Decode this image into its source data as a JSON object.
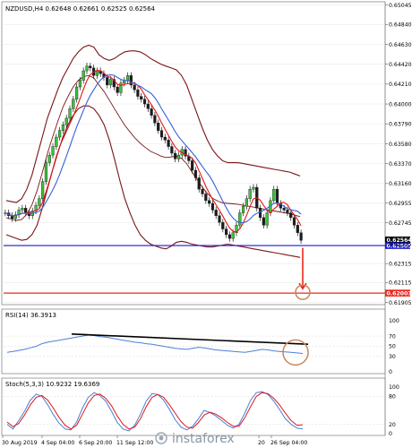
{
  "header": {
    "symbol_line": "NZDUSD,H4  0.62648 0.62661 0.62525 0.62564",
    "rsi_label": "RSI(14) 36.3913",
    "stoch_label": "Stoch(5,3,3) 10.9232 19.6369",
    "watermark": "instaforex"
  },
  "chart_data": [
    {
      "type": "line",
      "title": "NZDUSD,H4",
      "note": "price panel with Bollinger bands and moving averages",
      "ylim": [
        0.619,
        0.6506
      ],
      "y_ticks": [
        "0.65045",
        "0.64840",
        "0.64630",
        "0.64420",
        "0.64210",
        "0.64000",
        "0.63790",
        "0.63580",
        "0.63370",
        "0.63160",
        "0.62955",
        "0.62745",
        "0.62525",
        "0.62315",
        "0.62115",
        "0.61905"
      ],
      "x_labels": [
        "30 Aug 2019",
        "4 Sep 04:00",
        "6 Sep 20:00",
        "11 Sep 12:00",
        "20",
        "26 Sep 04:00"
      ],
      "price_tags": [
        {
          "label": "0.62564",
          "value": 0.62564,
          "color": "#000000"
        },
        {
          "label": "0.62505",
          "value": 0.62505,
          "color": "#1a1acc"
        },
        {
          "label": "0.62003",
          "value": 0.62003,
          "color": "#e8281e"
        }
      ],
      "horizontal_levels": [
        {
          "value": 0.62505,
          "color": "#1a1acc"
        },
        {
          "value": 0.62003,
          "color": "#e8281e"
        }
      ],
      "close": [
        0.6285,
        0.6282,
        0.6279,
        0.6283,
        0.6288,
        0.629,
        0.6285,
        0.6282,
        0.6287,
        0.6293,
        0.63,
        0.6318,
        0.6338,
        0.6346,
        0.6355,
        0.6365,
        0.6372,
        0.6378,
        0.6385,
        0.6395,
        0.6405,
        0.6418,
        0.6425,
        0.6435,
        0.644,
        0.6438,
        0.643,
        0.6435,
        0.6432,
        0.6428,
        0.642,
        0.6426,
        0.6418,
        0.6412,
        0.6422,
        0.6425,
        0.643,
        0.642,
        0.6415,
        0.6408,
        0.6405,
        0.64,
        0.6395,
        0.6388,
        0.638,
        0.6372,
        0.6365,
        0.6362,
        0.6355,
        0.6348,
        0.6342,
        0.6346,
        0.6352,
        0.6345,
        0.634,
        0.633,
        0.6322,
        0.631,
        0.6305,
        0.6298,
        0.6295,
        0.6288,
        0.6282,
        0.6275,
        0.6268,
        0.6262,
        0.6258,
        0.6264,
        0.6272,
        0.6285,
        0.6292,
        0.63,
        0.631,
        0.6312,
        0.629,
        0.628,
        0.6272,
        0.6285,
        0.6298,
        0.631,
        0.6295,
        0.629,
        0.6288,
        0.6285,
        0.628,
        0.6272,
        0.6264,
        0.6256
      ],
      "bb_upper": [
        0.6298,
        0.6297,
        0.6296,
        0.63,
        0.631,
        0.6325,
        0.6345,
        0.6365,
        0.6385,
        0.64,
        0.6415,
        0.6428,
        0.6438,
        0.6448,
        0.6455,
        0.646,
        0.6462,
        0.646,
        0.6452,
        0.6448,
        0.6446,
        0.6448,
        0.6452,
        0.6455,
        0.6456,
        0.6456,
        0.6455,
        0.6452,
        0.6448,
        0.6445,
        0.6442,
        0.644,
        0.6438,
        0.6436,
        0.643,
        0.642,
        0.6405,
        0.639,
        0.6375,
        0.6362,
        0.6352,
        0.6345,
        0.634,
        0.6338,
        0.6338,
        0.6338,
        0.6337,
        0.6336,
        0.6335,
        0.6334,
        0.6333,
        0.6332,
        0.6331,
        0.633,
        0.6329,
        0.6328,
        0.6326,
        0.6324
      ],
      "bb_lower": [
        0.6262,
        0.626,
        0.6258,
        0.6256,
        0.6257,
        0.6262,
        0.6272,
        0.629,
        0.631,
        0.633,
        0.6348,
        0.6365,
        0.6378,
        0.6388,
        0.6395,
        0.6398,
        0.6398,
        0.6395,
        0.6388,
        0.6378,
        0.6362,
        0.6342,
        0.632,
        0.63,
        0.6285,
        0.6272,
        0.6262,
        0.6256,
        0.6252,
        0.625,
        0.6248,
        0.6247,
        0.625,
        0.6254,
        0.6255,
        0.6254,
        0.6252,
        0.6251,
        0.625,
        0.6249,
        0.6249,
        0.625,
        0.6251,
        0.6252,
        0.6251,
        0.625,
        0.6249,
        0.6248,
        0.6247,
        0.6246,
        0.6245,
        0.6244,
        0.6243,
        0.6242,
        0.6241,
        0.624,
        0.6239,
        0.6238
      ],
      "forecast_arrow": {
        "from": 0.6248,
        "to": 0.6205,
        "color": "#e8281e"
      }
    },
    {
      "type": "line",
      "title": "RSI(14)",
      "ylim": [
        0,
        100
      ],
      "y_ticks": [
        "100",
        "70",
        "50",
        "30",
        "0"
      ],
      "values": [
        38,
        40,
        42,
        44,
        47,
        50,
        55,
        58,
        60,
        62,
        64,
        66,
        68,
        70,
        72,
        71,
        69,
        68,
        66,
        64,
        62,
        60,
        58,
        57,
        55,
        54,
        52,
        50,
        48,
        46,
        45,
        44,
        46,
        48,
        47,
        45,
        43,
        42,
        41,
        40,
        39,
        38,
        40,
        42,
        44,
        43,
        41,
        40,
        39,
        38,
        37,
        36
      ],
      "trendline": {
        "start": 74,
        "end": 54,
        "color": "#000000"
      }
    },
    {
      "type": "line",
      "title": "Stoch(5,3,3)",
      "ylim": [
        0,
        100
      ],
      "y_ticks": [
        "100",
        "80",
        "20",
        "0"
      ],
      "series": [
        {
          "values": [
            20,
            10,
            28,
            48,
            72,
            85,
            80,
            62,
            40,
            22,
            10,
            8,
            25,
            55,
            78,
            88,
            82,
            70,
            48,
            24,
            10,
            6,
            18,
            42,
            70,
            86,
            84,
            72,
            52,
            30,
            14,
            8,
            16,
            32,
            50,
            45,
            38,
            28,
            18,
            12,
            20,
            44,
            72,
            88,
            90,
            84,
            70,
            52,
            32,
            20,
            12,
            10
          ]
        },
        {
          "values": [
            25,
            15,
            22,
            40,
            62,
            78,
            82,
            72,
            54,
            34,
            18,
            10,
            18,
            42,
            66,
            82,
            85,
            76,
            60,
            38,
            20,
            10,
            14,
            32,
            58,
            78,
            84,
            78,
            62,
            44,
            26,
            14,
            12,
            24,
            40,
            46,
            42,
            34,
            24,
            16,
            16,
            34,
            58,
            80,
            88,
            86,
            76,
            62,
            44,
            28,
            18,
            19
          ]
        }
      ]
    }
  ]
}
